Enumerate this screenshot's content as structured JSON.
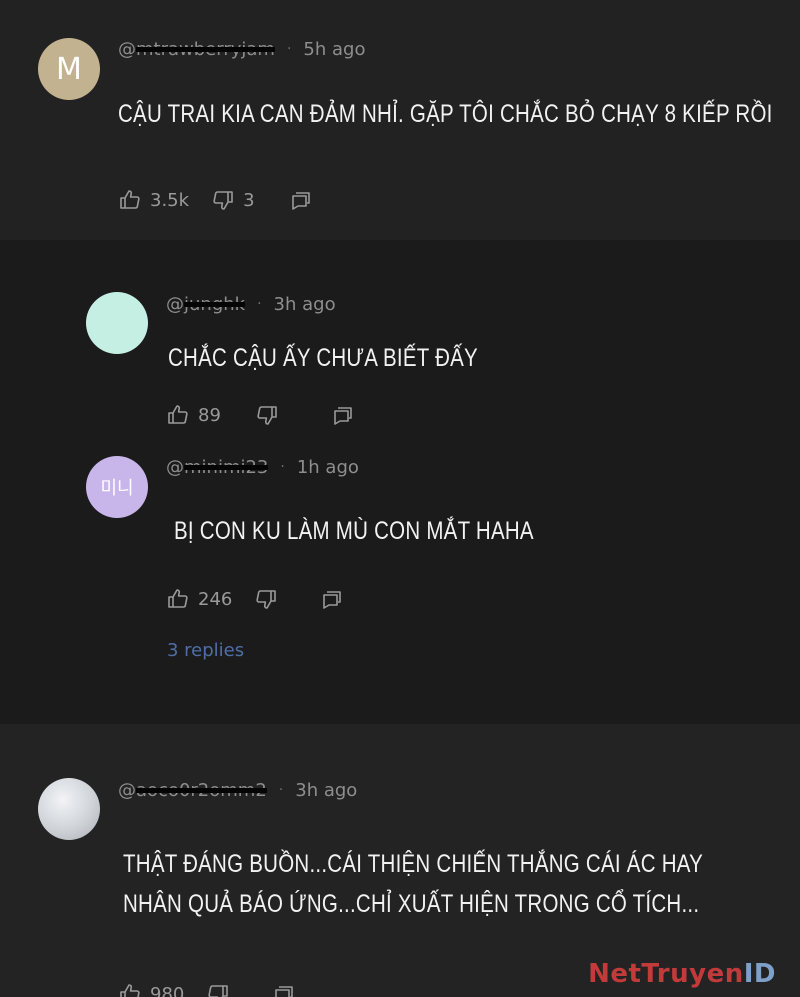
{
  "comments": [
    {
      "avatar_text": "M",
      "avatar_color": "#c2b28f",
      "username": "@mtrawberryjam",
      "time": "5h ago",
      "text_lines": [
        "CẬU TRAI KIA CAN ĐẢM NHỈ. GẶP TÔI CHẮC BỎ CHẠY 8 KIẾP RỒI"
      ],
      "likes": "3.5k",
      "dislikes": "3"
    }
  ],
  "replies": [
    {
      "avatar_text": "",
      "avatar_color": "#c6efe3",
      "username": "@junghk",
      "time": "3h ago",
      "text_lines": [
        "CHẮC CẬU ẤY CHƯA BIẾT ĐẤY"
      ],
      "likes": "89",
      "dislikes": ""
    },
    {
      "avatar_text": "미니",
      "avatar_color": "#c8b6ea",
      "username": "@minimi23",
      "time": "1h ago",
      "text_lines": [
        "BỊ CON KU LÀM MÙ CON MẮT HAHA"
      ],
      "likes": "246",
      "dislikes": ""
    }
  ],
  "replies_link": "3 replies",
  "bottom_comment": {
    "avatar_text": "",
    "avatar_color": "#cfd3d8",
    "username": "@aoco0r2omm2",
    "time": "3h ago",
    "text_lines": [
      "THẬT ĐÁNG BUỒN...CÁI THIỆN CHIẾN THẮNG CÁI ÁC HAY",
      "NHÂN QUẢ BÁO ỨNG...CHỈ XUẤT HIỆN TRONG CỔ TÍCH..."
    ],
    "likes": "980",
    "dislikes": ""
  },
  "separator": "·",
  "icons": {
    "like": "thumbs-up-icon",
    "dislike": "thumbs-down-icon",
    "reply": "reply-icon"
  },
  "watermark": {
    "part_a": "NetTruyen",
    "part_b": "ID"
  }
}
